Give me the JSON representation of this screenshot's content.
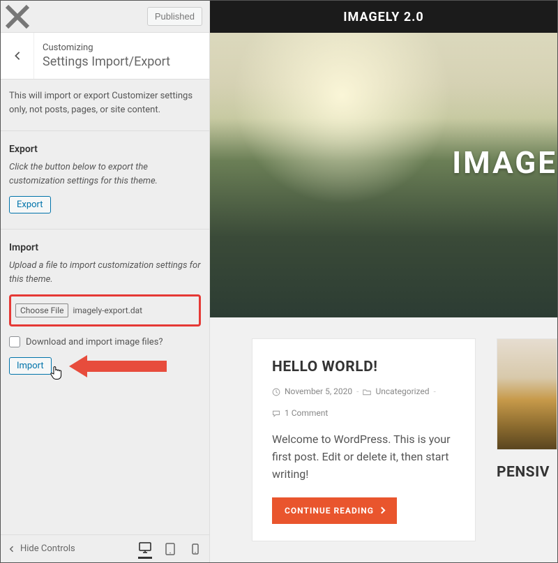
{
  "topbar": {
    "published_label": "Published"
  },
  "header": {
    "small": "Customizing",
    "big": "Settings Import/Export"
  },
  "desc": "This will import or export Customizer settings only, not posts, pages, or site content.",
  "export": {
    "title": "Export",
    "hint": "Click the button below to export the customization settings for this theme.",
    "button": "Export"
  },
  "import": {
    "title": "Import",
    "hint": "Upload a file to import customization settings for this theme.",
    "choose_label": "Choose File",
    "file_name": "imagely-export.dat",
    "checkbox_label": "Download and import image files?",
    "button": "Import"
  },
  "footer": {
    "hide_label": "Hide Controls"
  },
  "preview": {
    "brand": "IMAGELY 2.0",
    "hero_title": "IMAGE",
    "post": {
      "title": "HELLO WORLD!",
      "date": "November 5, 2020",
      "category": "Uncategorized",
      "comments": "1 Comment",
      "body": "Welcome to WordPress. This is your first post. Edit or delete it, then start writing!",
      "continue": "CONTINUE READING"
    },
    "side_post_title": "PENSIV"
  }
}
